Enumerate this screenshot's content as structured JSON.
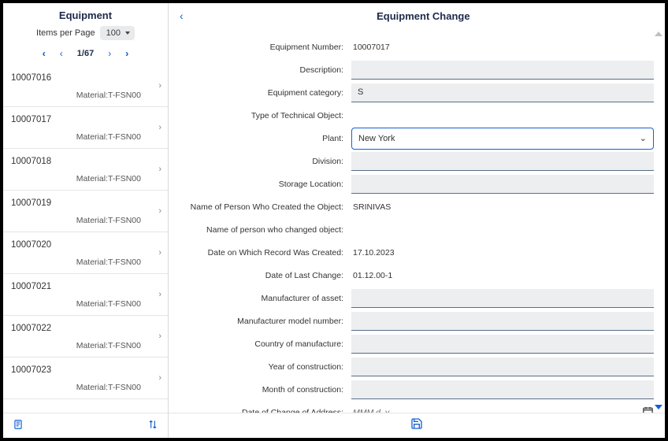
{
  "sidebar": {
    "title": "Equipment",
    "itemsPerPageLabel": "Items per Page",
    "itemsPerPageValue": "100",
    "pageDisplay": "1/67",
    "materialLabel": "Material:",
    "rows": [
      {
        "num": "10007016",
        "mat": "T-FSN00"
      },
      {
        "num": "10007017",
        "mat": "T-FSN00"
      },
      {
        "num": "10007018",
        "mat": "T-FSN00"
      },
      {
        "num": "10007019",
        "mat": "T-FSN00"
      },
      {
        "num": "10007020",
        "mat": "T-FSN00"
      },
      {
        "num": "10007021",
        "mat": "T-FSN00"
      },
      {
        "num": "10007022",
        "mat": "T-FSN00"
      },
      {
        "num": "10007023",
        "mat": "T-FSN00"
      }
    ]
  },
  "detail": {
    "title": "Equipment Change",
    "labels": {
      "equipmentNumber": "Equipment Number:",
      "description": "Description:",
      "equipmentCategory": "Equipment category:",
      "typeOfTechObject": "Type of Technical Object:",
      "plant": "Plant:",
      "division": "Division:",
      "storageLocation": "Storage Location:",
      "createdBy": "Name of Person Who Created the Object:",
      "changedBy": "Name of person who changed object:",
      "dateCreated": "Date on Which Record Was Created:",
      "dateLastChange": "Date of Last Change:",
      "manufacturer": "Manufacturer of asset:",
      "modelNumber": "Manufacturer model number:",
      "country": "Country of manufacture:",
      "yearConstruction": "Year of construction:",
      "monthConstruction": "Month of construction:",
      "dateChangeAddress": "Date of Change of Address:"
    },
    "values": {
      "equipmentNumber": "10007017",
      "description": "",
      "equipmentCategory": "S",
      "typeOfTechObject": "",
      "plant": "New York",
      "division": "",
      "storageLocation": "",
      "createdBy": "SRINIVAS",
      "changedBy": "",
      "dateCreated": "17.10.2023",
      "dateLastChange": "01.12.00-1",
      "manufacturer": "",
      "modelNumber": "",
      "country": "",
      "yearConstruction": "",
      "monthConstruction": "",
      "dateChangeAddressPlaceholder": "MMM d, y"
    }
  }
}
